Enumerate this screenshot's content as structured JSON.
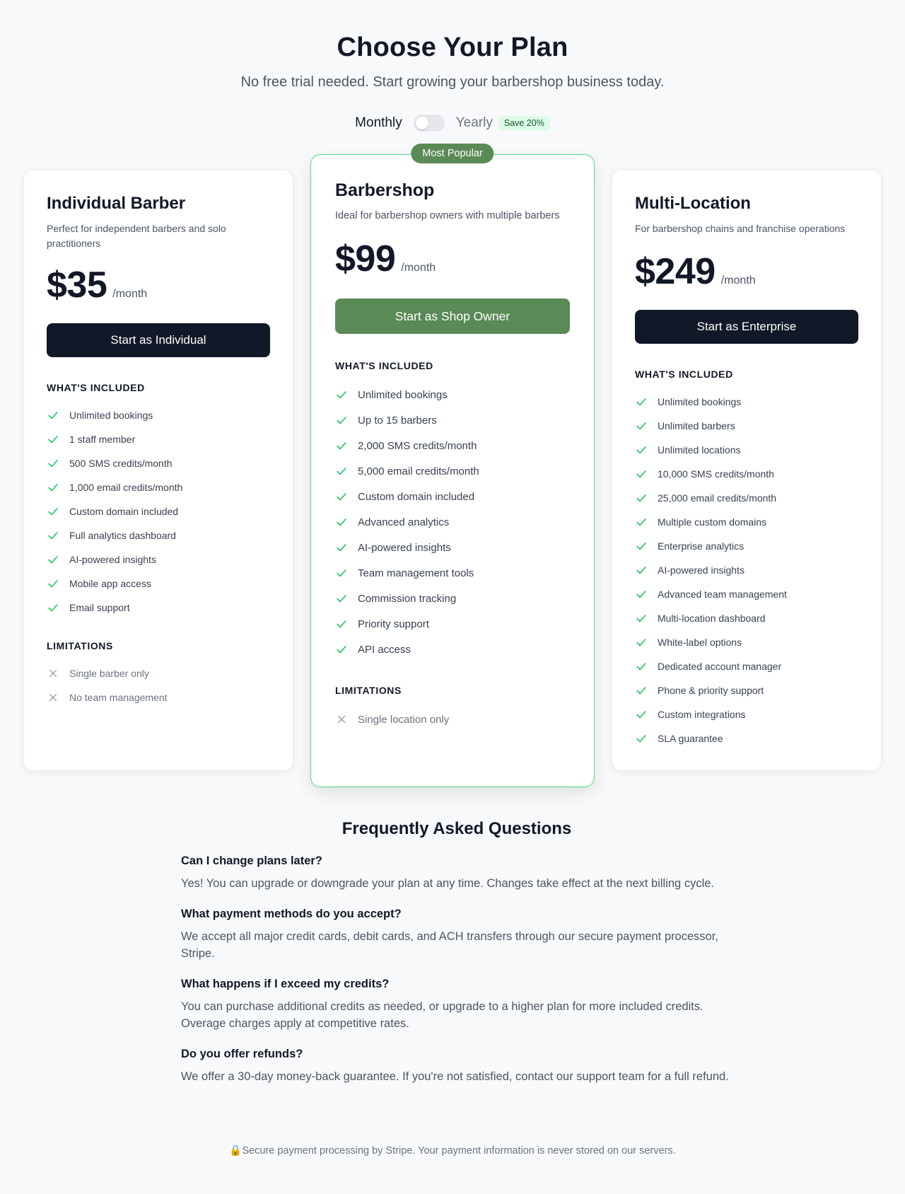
{
  "header": {
    "title": "Choose Your Plan",
    "subtitle": "No free trial needed. Start growing your barbershop business today."
  },
  "billing": {
    "monthly_label": "Monthly",
    "yearly_label": "Yearly",
    "save_badge": "Save 20%",
    "yearly_enabled": false
  },
  "plans": [
    {
      "name": "Individual Barber",
      "description": "Perfect for independent barbers and solo practitioners",
      "price": "$35",
      "period": "/month",
      "cta": "Start as Individual",
      "included_heading": "WHAT'S INCLUDED",
      "features": [
        "Unlimited bookings",
        "1 staff member",
        "500 SMS credits/month",
        "1,000 email credits/month",
        "Custom domain included",
        "Full analytics dashboard",
        "AI-powered insights",
        "Mobile app access",
        "Email support"
      ],
      "limitations_heading": "LIMITATIONS",
      "limitations": [
        "Single barber only",
        "No team management"
      ]
    },
    {
      "badge": "Most Popular",
      "name": "Barbershop",
      "description": "Ideal for barbershop owners with multiple barbers",
      "price": "$99",
      "period": "/month",
      "cta": "Start as Shop Owner",
      "included_heading": "WHAT'S INCLUDED",
      "features": [
        "Unlimited bookings",
        "Up to 15 barbers",
        "2,000 SMS credits/month",
        "5,000 email credits/month",
        "Custom domain included",
        "Advanced analytics",
        "AI-powered insights",
        "Team management tools",
        "Commission tracking",
        "Priority support",
        "API access"
      ],
      "limitations_heading": "LIMITATIONS",
      "limitations": [
        "Single location only"
      ]
    },
    {
      "name": "Multi-Location",
      "description": "For barbershop chains and franchise operations",
      "price": "$249",
      "period": "/month",
      "cta": "Start as Enterprise",
      "included_heading": "WHAT'S INCLUDED",
      "features": [
        "Unlimited bookings",
        "Unlimited barbers",
        "Unlimited locations",
        "10,000 SMS credits/month",
        "25,000 email credits/month",
        "Multiple custom domains",
        "Enterprise analytics",
        "AI-powered insights",
        "Advanced team management",
        "Multi-location dashboard",
        "White-label options",
        "Dedicated account manager",
        "Phone & priority support",
        "Custom integrations",
        "SLA guarantee"
      ]
    }
  ],
  "faq": {
    "title": "Frequently Asked Questions",
    "items": [
      {
        "q": "Can I change plans later?",
        "a": "Yes! You can upgrade or downgrade your plan at any time. Changes take effect at the next billing cycle."
      },
      {
        "q": "What payment methods do you accept?",
        "a": "We accept all major credit cards, debit cards, and ACH transfers through our secure payment processor, Stripe."
      },
      {
        "q": "What happens if I exceed my credits?",
        "a": "You can purchase additional credits as needed, or upgrade to a higher plan for more included credits. Overage charges apply at competitive rates."
      },
      {
        "q": "Do you offer refunds?",
        "a": "We offer a 30-day money-back guarantee. If you're not satisfied, contact our support team for a full refund."
      }
    ]
  },
  "footer": {
    "lock_icon": "🔒",
    "note": "Secure payment processing by Stripe. Your payment information is never stored on our servers."
  },
  "colors": {
    "accent_green": "#5a8a55",
    "check_green": "#22c55e",
    "featured_border": "#4ade80",
    "dark_button": "#111827"
  }
}
